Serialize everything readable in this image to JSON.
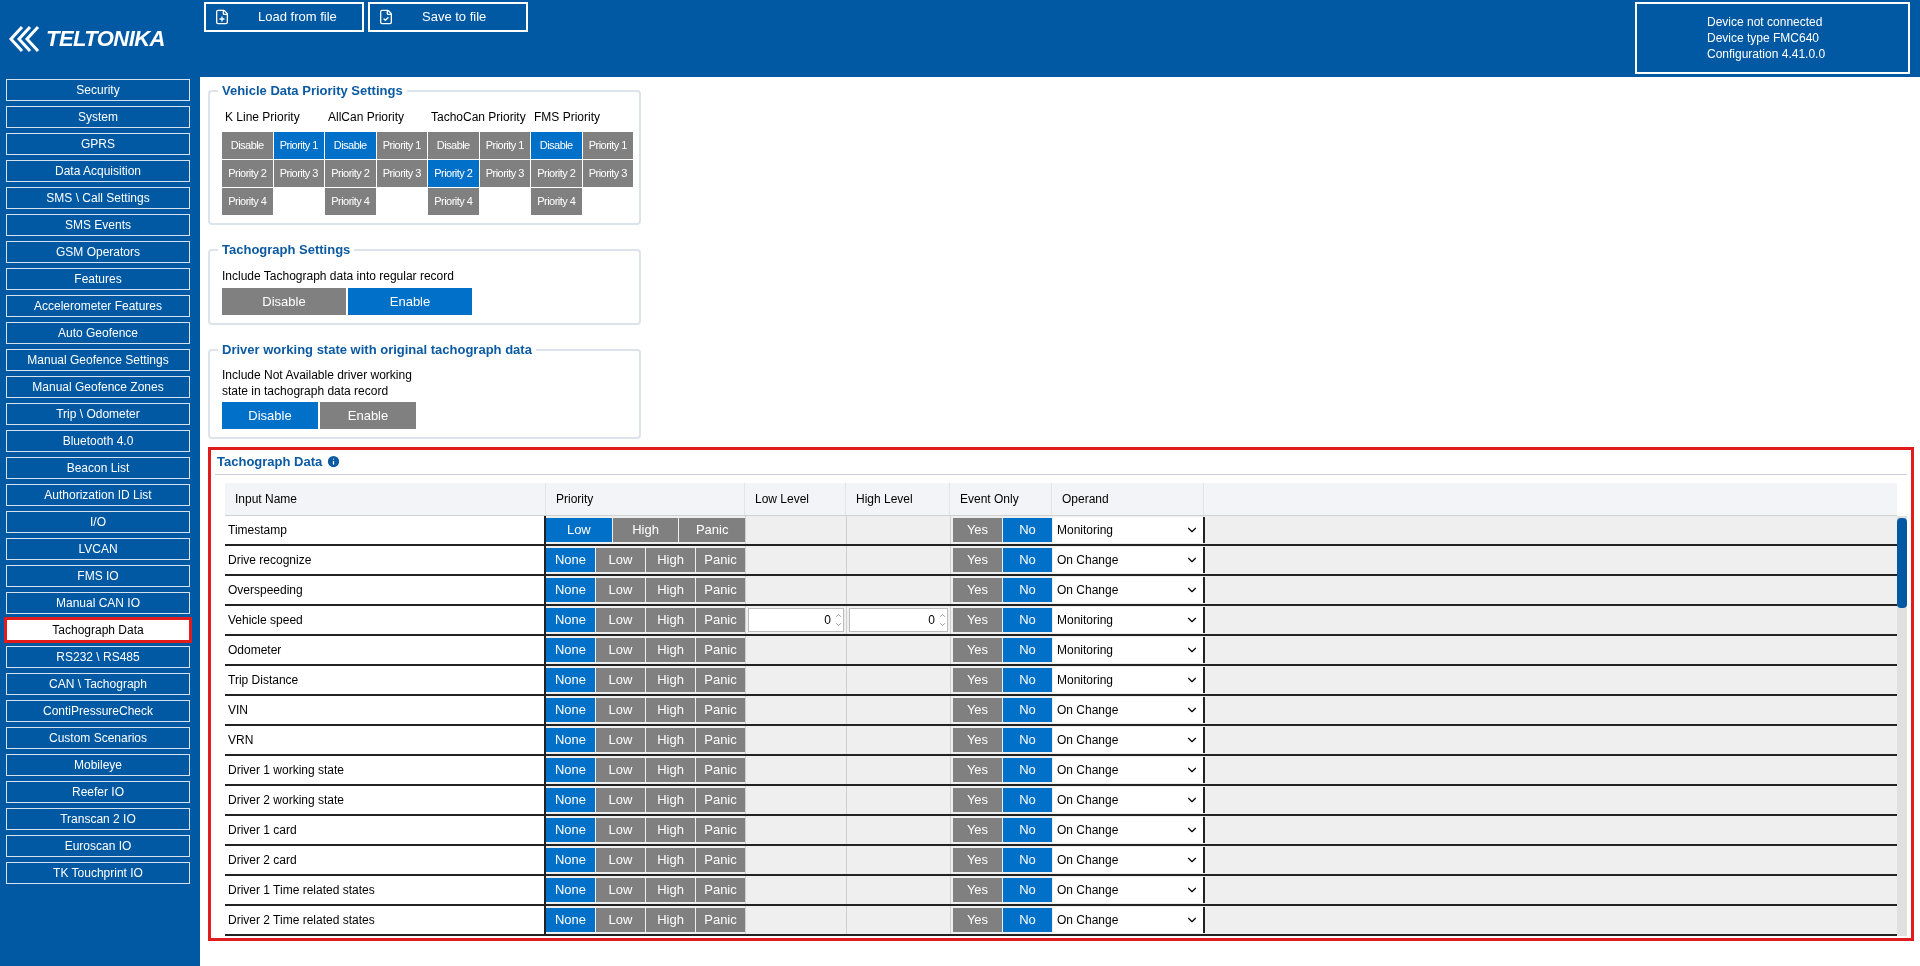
{
  "logo": {
    "text": "TELTONIKA"
  },
  "toolbar": [
    {
      "kind": "load",
      "label": "Load from file"
    },
    {
      "kind": "save",
      "label": "Save to file"
    }
  ],
  "device_info": [
    "Device not connected",
    "Device type  FMC640",
    "Configuration  4.41.0.0"
  ],
  "sidebar": {
    "items": [
      {
        "label": "Security",
        "selected": false
      },
      {
        "label": "System",
        "selected": false
      },
      {
        "label": "GPRS",
        "selected": false
      },
      {
        "label": "Data Acquisition",
        "selected": false
      },
      {
        "label": "SMS \\ Call Settings",
        "selected": false
      },
      {
        "label": "SMS Events",
        "selected": false
      },
      {
        "label": "GSM Operators",
        "selected": false
      },
      {
        "label": "Features",
        "selected": false
      },
      {
        "label": "Accelerometer Features",
        "selected": false
      },
      {
        "label": "Auto Geofence",
        "selected": false
      },
      {
        "label": "Manual Geofence Settings",
        "selected": false
      },
      {
        "label": "Manual Geofence Zones",
        "selected": false
      },
      {
        "label": "Trip \\ Odometer",
        "selected": false
      },
      {
        "label": "Bluetooth 4.0",
        "selected": false
      },
      {
        "label": "Beacon List",
        "selected": false
      },
      {
        "label": "Authorization ID List",
        "selected": false
      },
      {
        "label": "I/O",
        "selected": false
      },
      {
        "label": "LVCAN",
        "selected": false
      },
      {
        "label": "FMS IO",
        "selected": false
      },
      {
        "label": "Manual CAN IO",
        "selected": false
      },
      {
        "label": "Tachograph Data",
        "selected": true
      },
      {
        "label": "RS232 \\ RS485",
        "selected": false
      },
      {
        "label": "CAN \\ Tachograph",
        "selected": false
      },
      {
        "label": "ContiPressureCheck",
        "selected": false
      },
      {
        "label": "Custom Scenarios",
        "selected": false
      },
      {
        "label": "Mobileye",
        "selected": false
      },
      {
        "label": "Reefer IO",
        "selected": false
      },
      {
        "label": "Transcan 2 IO",
        "selected": false
      },
      {
        "label": "Euroscan IO",
        "selected": false
      },
      {
        "label": "TK Touchprint IO",
        "selected": false
      }
    ]
  },
  "vehicle_priority": {
    "title": "Vehicle Data Priority Settings",
    "groups": [
      {
        "label": "K Line Priority",
        "options": [
          {
            "label": "Disable",
            "selected": false
          },
          {
            "label": "Priority 1",
            "selected": true
          },
          {
            "label": "Priority 2",
            "selected": false
          },
          {
            "label": "Priority 3",
            "selected": false
          },
          {
            "label": "Priority 4",
            "selected": false
          }
        ]
      },
      {
        "label": "AllCan Priority",
        "options": [
          {
            "label": "Disable",
            "selected": true
          },
          {
            "label": "Priority 1",
            "selected": false
          },
          {
            "label": "Priority 2",
            "selected": false
          },
          {
            "label": "Priority 3",
            "selected": false
          },
          {
            "label": "Priority 4",
            "selected": false
          }
        ]
      },
      {
        "label": "TachoCan Priority",
        "options": [
          {
            "label": "Disable",
            "selected": false
          },
          {
            "label": "Priority 1",
            "selected": false
          },
          {
            "label": "Priority 2",
            "selected": true
          },
          {
            "label": "Priority 3",
            "selected": false
          },
          {
            "label": "Priority 4",
            "selected": false
          }
        ]
      },
      {
        "label": "FMS Priority",
        "options": [
          {
            "label": "Disable",
            "selected": true
          },
          {
            "label": "Priority 1",
            "selected": false
          },
          {
            "label": "Priority 2",
            "selected": false
          },
          {
            "label": "Priority 3",
            "selected": false
          },
          {
            "label": "Priority 4",
            "selected": false
          }
        ]
      }
    ]
  },
  "tachograph_settings": {
    "title": "Tachograph Settings",
    "label": "Include Tachograph data into regular record",
    "options": [
      {
        "label": "Disable",
        "selected": false
      },
      {
        "label": "Enable",
        "selected": true
      }
    ]
  },
  "driver_state": {
    "title": "Driver working state with original tachograph data",
    "label": "Include Not Available driver working state in tachograph data record",
    "options": [
      {
        "label": "Disable",
        "selected": true
      },
      {
        "label": "Enable",
        "selected": false
      }
    ]
  },
  "tachograph_data": {
    "title": "Tachograph Data",
    "highlighted": true,
    "columns": [
      "Input Name",
      "Priority",
      "Low Level",
      "High Level",
      "Event Only",
      "Operand"
    ],
    "rows": [
      {
        "name": "Timestamp",
        "priority": [
          {
            "label": "Low",
            "selected": true
          },
          {
            "label": "High",
            "selected": false
          },
          {
            "label": "Panic",
            "selected": false
          }
        ],
        "event_only": [
          {
            "label": "Yes",
            "selected": false
          },
          {
            "label": "No",
            "selected": true
          }
        ],
        "operand": "Monitoring"
      },
      {
        "name": "Drive recognize",
        "priority": [
          {
            "label": "None",
            "selected": true
          },
          {
            "label": "Low",
            "selected": false
          },
          {
            "label": "High",
            "selected": false
          },
          {
            "label": "Panic",
            "selected": false
          }
        ],
        "event_only": [
          {
            "label": "Yes",
            "selected": false
          },
          {
            "label": "No",
            "selected": true
          }
        ],
        "operand": "On Change"
      },
      {
        "name": "Overspeeding",
        "priority": [
          {
            "label": "None",
            "selected": true
          },
          {
            "label": "Low",
            "selected": false
          },
          {
            "label": "High",
            "selected": false
          },
          {
            "label": "Panic",
            "selected": false
          }
        ],
        "event_only": [
          {
            "label": "Yes",
            "selected": false
          },
          {
            "label": "No",
            "selected": true
          }
        ],
        "operand": "On Change"
      },
      {
        "name": "Vehicle speed",
        "priority": [
          {
            "label": "None",
            "selected": true
          },
          {
            "label": "Low",
            "selected": false
          },
          {
            "label": "High",
            "selected": false
          },
          {
            "label": "Panic",
            "selected": false
          }
        ],
        "low_level": "0",
        "high_level": "0",
        "event_only": [
          {
            "label": "Yes",
            "selected": false
          },
          {
            "label": "No",
            "selected": true
          }
        ],
        "operand": "Monitoring"
      },
      {
        "name": "Odometer",
        "priority": [
          {
            "label": "None",
            "selected": true
          },
          {
            "label": "Low",
            "selected": false
          },
          {
            "label": "High",
            "selected": false
          },
          {
            "label": "Panic",
            "selected": false
          }
        ],
        "event_only": [
          {
            "label": "Yes",
            "selected": false
          },
          {
            "label": "No",
            "selected": true
          }
        ],
        "operand": "Monitoring"
      },
      {
        "name": "Trip Distance",
        "priority": [
          {
            "label": "None",
            "selected": true
          },
          {
            "label": "Low",
            "selected": false
          },
          {
            "label": "High",
            "selected": false
          },
          {
            "label": "Panic",
            "selected": false
          }
        ],
        "event_only": [
          {
            "label": "Yes",
            "selected": false
          },
          {
            "label": "No",
            "selected": true
          }
        ],
        "operand": "Monitoring"
      },
      {
        "name": "VIN",
        "priority": [
          {
            "label": "None",
            "selected": true
          },
          {
            "label": "Low",
            "selected": false
          },
          {
            "label": "High",
            "selected": false
          },
          {
            "label": "Panic",
            "selected": false
          }
        ],
        "event_only": [
          {
            "label": "Yes",
            "selected": false
          },
          {
            "label": "No",
            "selected": true
          }
        ],
        "operand": "On Change"
      },
      {
        "name": "VRN",
        "priority": [
          {
            "label": "None",
            "selected": true
          },
          {
            "label": "Low",
            "selected": false
          },
          {
            "label": "High",
            "selected": false
          },
          {
            "label": "Panic",
            "selected": false
          }
        ],
        "event_only": [
          {
            "label": "Yes",
            "selected": false
          },
          {
            "label": "No",
            "selected": true
          }
        ],
        "operand": "On Change"
      },
      {
        "name": "Driver 1 working state",
        "priority": [
          {
            "label": "None",
            "selected": true
          },
          {
            "label": "Low",
            "selected": false
          },
          {
            "label": "High",
            "selected": false
          },
          {
            "label": "Panic",
            "selected": false
          }
        ],
        "event_only": [
          {
            "label": "Yes",
            "selected": false
          },
          {
            "label": "No",
            "selected": true
          }
        ],
        "operand": "On Change"
      },
      {
        "name": "Driver 2 working state",
        "priority": [
          {
            "label": "None",
            "selected": true
          },
          {
            "label": "Low",
            "selected": false
          },
          {
            "label": "High",
            "selected": false
          },
          {
            "label": "Panic",
            "selected": false
          }
        ],
        "event_only": [
          {
            "label": "Yes",
            "selected": false
          },
          {
            "label": "No",
            "selected": true
          }
        ],
        "operand": "On Change"
      },
      {
        "name": "Driver 1 card",
        "priority": [
          {
            "label": "None",
            "selected": true
          },
          {
            "label": "Low",
            "selected": false
          },
          {
            "label": "High",
            "selected": false
          },
          {
            "label": "Panic",
            "selected": false
          }
        ],
        "event_only": [
          {
            "label": "Yes",
            "selected": false
          },
          {
            "label": "No",
            "selected": true
          }
        ],
        "operand": "On Change"
      },
      {
        "name": "Driver 2 card",
        "priority": [
          {
            "label": "None",
            "selected": true
          },
          {
            "label": "Low",
            "selected": false
          },
          {
            "label": "High",
            "selected": false
          },
          {
            "label": "Panic",
            "selected": false
          }
        ],
        "event_only": [
          {
            "label": "Yes",
            "selected": false
          },
          {
            "label": "No",
            "selected": true
          }
        ],
        "operand": "On Change"
      },
      {
        "name": "Driver 1 Time related states",
        "priority": [
          {
            "label": "None",
            "selected": true
          },
          {
            "label": "Low",
            "selected": false
          },
          {
            "label": "High",
            "selected": false
          },
          {
            "label": "Panic",
            "selected": false
          }
        ],
        "event_only": [
          {
            "label": "Yes",
            "selected": false
          },
          {
            "label": "No",
            "selected": true
          }
        ],
        "operand": "On Change"
      },
      {
        "name": "Driver 2 Time related states",
        "priority": [
          {
            "label": "None",
            "selected": true
          },
          {
            "label": "Low",
            "selected": false
          },
          {
            "label": "High",
            "selected": false
          },
          {
            "label": "Panic",
            "selected": false
          }
        ],
        "event_only": [
          {
            "label": "Yes",
            "selected": false
          },
          {
            "label": "No",
            "selected": true
          }
        ],
        "operand": "On Change"
      }
    ]
  }
}
